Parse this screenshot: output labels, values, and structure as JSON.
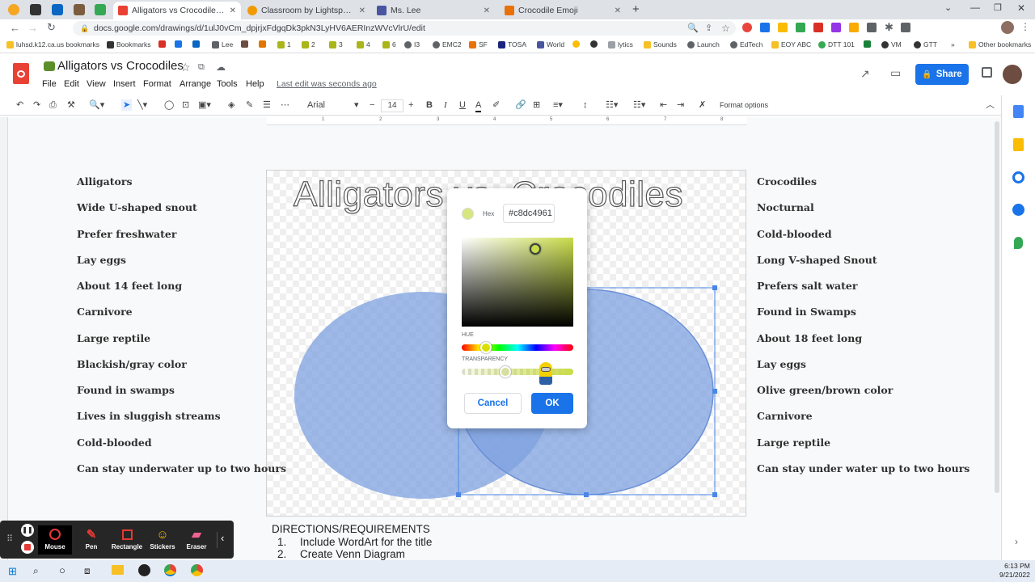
{
  "browser": {
    "tabs": [
      {
        "title": "Alligators vs Crocodiles - Goo",
        "icon": "google-drawings-icon",
        "color": "#e94235"
      },
      {
        "title": "Classroom by Lightspeed System",
        "icon": "lightspeed-icon",
        "color": "#f29900"
      },
      {
        "title": "Ms. Lee",
        "icon": "forms-icon",
        "color": "#4a55a2"
      },
      {
        "title": "Crocodile Emoji",
        "icon": "crocodile-emoji-icon",
        "color": "#e8710a"
      }
    ],
    "url": "docs.google.com/drawings/d/1ulJ0vCm_dpjrjxFdgqDk3pkN3LyHV6AERInzWVcVlrU/edit",
    "bookmarks": [
      "luhsd.k12.ca.us bookmarks",
      "Bookmarks",
      "Lee",
      "1",
      "2",
      "3",
      "4",
      "6",
      "I3",
      "EMC2",
      "SF",
      "TOSA",
      "World",
      "lytics",
      "Sounds",
      "Launch",
      "EdTech",
      "EOY ABC",
      "DTT 101",
      "VM",
      "GTT",
      "Other bookmarks"
    ]
  },
  "doc": {
    "title": "Alligators vs Crocodiles",
    "menus": [
      "File",
      "Edit",
      "View",
      "Insert",
      "Format",
      "Arrange",
      "Tools",
      "Help"
    ],
    "last_edit": "Last edit was seconds ago",
    "share_label": "Share"
  },
  "toolbar": {
    "font": "Arial",
    "font_size": "14",
    "format_options": "Format options"
  },
  "ruler_marks": [
    "1",
    "2",
    "3",
    "4",
    "5",
    "6",
    "7",
    "8"
  ],
  "drawing": {
    "wordart": "Alligators vs. Crocodiles",
    "circle_color": "#7ea1e0"
  },
  "alligators": [
    "Alligators",
    "Wide U-shaped snout",
    "Prefer freshwater",
    "Lay eggs",
    "About 14 feet long",
    "Carnivore",
    "Large reptile",
    "Blackish/gray color",
    "Found in swamps",
    "Lives in sluggish streams",
    "Cold-blooded",
    "Can stay underwater up to two hours"
  ],
  "crocodiles": [
    "Crocodiles",
    "Nocturnal",
    "Cold-blooded",
    "Long V-shaped Snout",
    "Prefers salt water",
    "Found in Swamps",
    "About 18 feet long",
    "Lay eggs",
    "Olive green/brown color",
    "Carnivore",
    "Large reptile",
    "Can stay under water up to two hours"
  ],
  "color_picker": {
    "hex_label": "Hex",
    "hex_value": "#c8dc4961",
    "hue_label": "HUE",
    "transparency_label": "TRANSPARENCY",
    "cancel_label": "Cancel",
    "ok_label": "OK",
    "selected_color": "#c8dc49",
    "transparency_level": 0.38
  },
  "directions": {
    "heading": "DIRECTIONS/REQUIREMENTS",
    "items": [
      {
        "num": "1.",
        "text": "Include WordArt for the title"
      },
      {
        "num": "2.",
        "text": "Create Venn Diagram"
      }
    ]
  },
  "annotate_tools": [
    "Mouse",
    "Pen",
    "Rectangle",
    "Stickers",
    "Eraser"
  ],
  "taskbar": {
    "time": "6:13 PM",
    "date": "9/21/2022"
  }
}
